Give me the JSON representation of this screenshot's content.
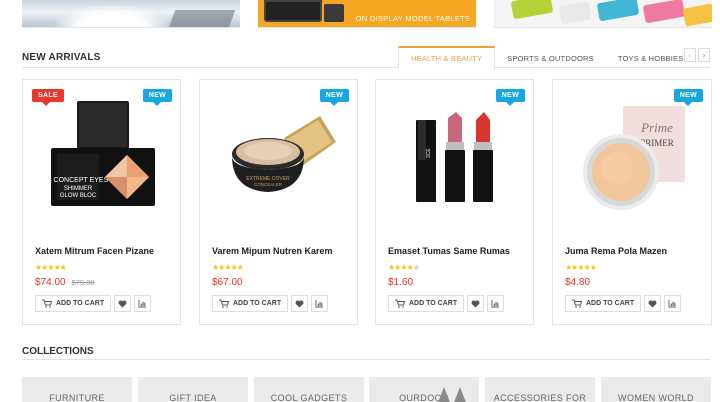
{
  "banners": {
    "tablet_headline": "",
    "tablet_subline": "ON DISPLAY MODEL TABLETS"
  },
  "new_arrivals": {
    "title": "NEW ARRIVALS",
    "tabs": [
      {
        "label": "HEALTH & BEAUTY",
        "active": true
      },
      {
        "label": "SPORTS & OUTDOORS",
        "active": false
      },
      {
        "label": "TOYS & HOBBIES",
        "active": false
      }
    ],
    "prev_arrow": "‹",
    "next_arrow": "›"
  },
  "products": [
    {
      "name": "Xatem Mitrum Facen Pizane",
      "price": "$74.00",
      "old_price": "$79.00",
      "badges": [
        "SALE",
        "NEW"
      ],
      "rating": 4.5,
      "stars": "★★★★★"
    },
    {
      "name": "Varem Mipum Nutren Karem",
      "price": "$67.00",
      "old_price": "",
      "badges": [
        "NEW"
      ],
      "rating": 4.5,
      "stars": "★★★★★"
    },
    {
      "name": "Emaset Tumas Same Rumas",
      "price": "$1.60",
      "old_price": "",
      "badges": [
        "NEW"
      ],
      "rating": 4,
      "stars": "★★★★"
    },
    {
      "name": "Juma Rema Pola Mazen",
      "price": "$4.80",
      "old_price": "",
      "badges": [
        "NEW"
      ],
      "rating": 4.5,
      "stars": "★★★★★"
    }
  ],
  "labels": {
    "add_to_cart": "ADD TO CART",
    "sale": "SALE",
    "new": "NEW",
    "star_off": "★"
  },
  "collections": {
    "title": "COLLECTIONS",
    "items": [
      "FURNITURE",
      "GIFT IDEA",
      "COOL GADGETS",
      "OURDOOR",
      "ACCESSORIES FOR",
      "WOMEN WORLD"
    ]
  },
  "colors": {
    "accent": "#f0a036",
    "price": "#e2341d",
    "sale_badge": "#e9372b",
    "new_badge": "#18a7e0",
    "star": "#f5c518"
  }
}
